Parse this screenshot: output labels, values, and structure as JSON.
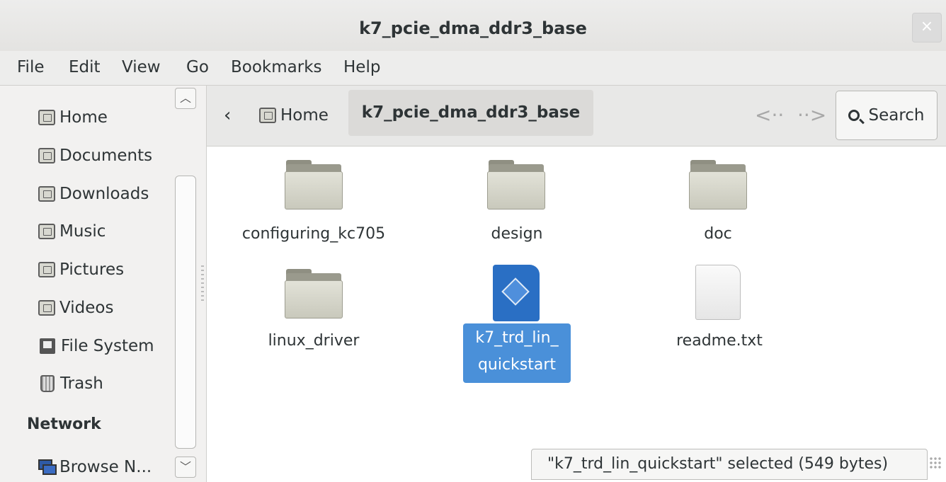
{
  "window": {
    "title": "k7_pcie_dma_ddr3_base",
    "close_symbol": "×"
  },
  "menu": [
    "File",
    "Edit",
    "View",
    "Go",
    "Bookmarks",
    "Help"
  ],
  "sidebar": {
    "places": [
      "Home",
      "Documents",
      "Downloads",
      "Music",
      "Pictures",
      "Videos",
      "File System",
      "Trash"
    ],
    "network_label": "Network",
    "network_items": [
      "Browse N..."
    ]
  },
  "pathbar": {
    "home": "Home",
    "current": "k7_pcie_dma_ddr3_base",
    "search_label": "Search"
  },
  "files": [
    {
      "name": "configuring_kc705",
      "type": "folder"
    },
    {
      "name": "design",
      "type": "folder"
    },
    {
      "name": "doc",
      "type": "folder"
    },
    {
      "name": "linux_driver",
      "type": "folder"
    },
    {
      "name_line1": "k7_trd_lin_",
      "name_line2": "quickstart",
      "type": "executable",
      "selected": true
    },
    {
      "name": "readme.txt",
      "type": "text"
    }
  ],
  "status": "\"k7_trd_lin_quickstart\" selected (549 bytes)",
  "colors": {
    "selection": "#4a90d9",
    "folder": "#c9c9bc"
  }
}
